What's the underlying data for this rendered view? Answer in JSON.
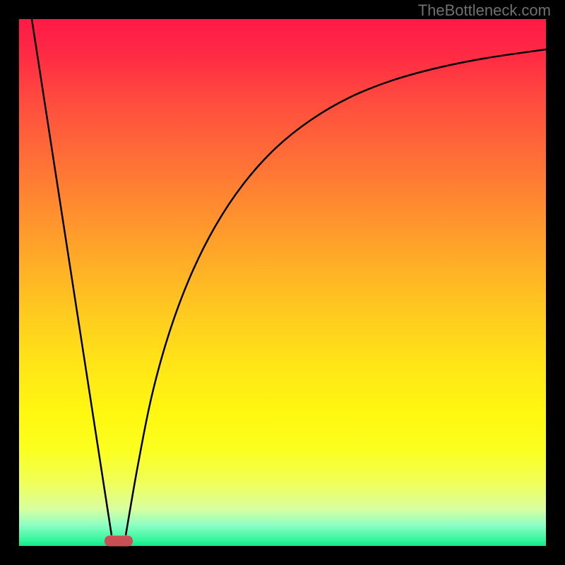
{
  "watermark": "TheBottleneck.com",
  "chart_data": {
    "type": "line",
    "title": "",
    "xlabel": "",
    "ylabel": "",
    "xlim": [
      27,
      773
    ],
    "ylim": [
      27,
      773
    ],
    "gradient": {
      "direction": "vertical",
      "stops": [
        {
          "pos": 0.0,
          "color": "#ff1a47"
        },
        {
          "pos": 0.5,
          "color": "#ffc820"
        },
        {
          "pos": 0.82,
          "color": "#fbff20"
        },
        {
          "pos": 1.0,
          "color": "#14e68a"
        }
      ]
    },
    "series": [
      {
        "name": "left-line",
        "type": "line",
        "points": [
          {
            "x": 45,
            "y": 27
          },
          {
            "x": 158,
            "y": 758
          }
        ]
      },
      {
        "name": "right-curve",
        "type": "curve",
        "points": [
          {
            "x": 178,
            "y": 758
          },
          {
            "x": 195,
            "y": 660
          },
          {
            "x": 215,
            "y": 560
          },
          {
            "x": 240,
            "y": 470
          },
          {
            "x": 270,
            "y": 390
          },
          {
            "x": 305,
            "y": 320
          },
          {
            "x": 345,
            "y": 260
          },
          {
            "x": 390,
            "y": 210
          },
          {
            "x": 440,
            "y": 170
          },
          {
            "x": 495,
            "y": 138
          },
          {
            "x": 555,
            "y": 114
          },
          {
            "x": 620,
            "y": 96
          },
          {
            "x": 690,
            "y": 82
          },
          {
            "x": 773,
            "y": 70
          }
        ]
      }
    ],
    "marker": {
      "x": 168,
      "y": 766,
      "color": "#c94f55",
      "shape": "rounded-rect"
    }
  }
}
